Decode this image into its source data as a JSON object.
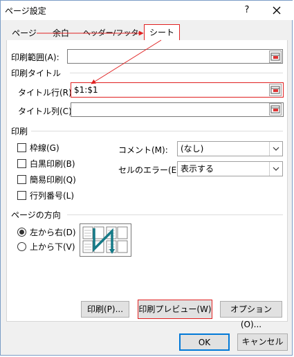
{
  "window": {
    "title": "ページ設定",
    "help": "?"
  },
  "tabs": [
    {
      "label": "ページ"
    },
    {
      "label": "余白"
    },
    {
      "label": "ヘッダー/フッター"
    },
    {
      "label": "シート"
    }
  ],
  "print_area": {
    "label": "印刷範囲(A):",
    "value": ""
  },
  "print_titles": {
    "heading": "印刷タイトル",
    "rows_label": "タイトル行(R):",
    "rows_value": "$1:$1",
    "cols_label": "タイトル列(C):",
    "cols_value": ""
  },
  "print": {
    "heading": "印刷",
    "checkboxes": [
      {
        "label": "枠線(G)",
        "checked": false
      },
      {
        "label": "白黒印刷(B)",
        "checked": false
      },
      {
        "label": "簡易印刷(Q)",
        "checked": false
      },
      {
        "label": "行列番号(L)",
        "checked": false
      }
    ],
    "comments_label": "コメント(M):",
    "comments_value": "(なし)",
    "errors_label": "セルのエラー(E):",
    "errors_value": "表示する"
  },
  "page_order": {
    "heading": "ページの方向",
    "options": [
      {
        "label": "左から右(D)",
        "selected": true
      },
      {
        "label": "上から下(V)",
        "selected": false
      }
    ]
  },
  "buttons": {
    "print": "印刷(P)...",
    "preview": "印刷プレビュー(W)",
    "options": "オプション(O)...",
    "ok": "OK",
    "cancel": "キャンセル"
  },
  "colors": {
    "annotation_red": "#e02020",
    "accent_blue": "#0078d7"
  }
}
